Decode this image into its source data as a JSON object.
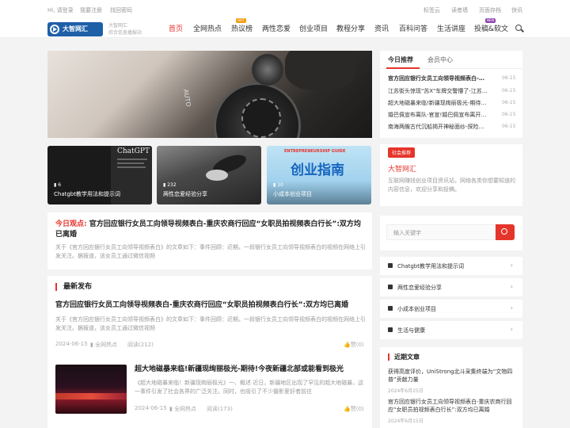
{
  "topbar": {
    "left": [
      "Hi, 请登录",
      "我要注册",
      "找回密码"
    ],
    "right": [
      "标签云",
      "读者墙",
      "页面存档",
      "快讯"
    ]
  },
  "brand": {
    "logo": "大智网汇",
    "sub_line1": "大智网汇",
    "sub_line2": "综合信息播报站"
  },
  "nav": {
    "items": [
      "首页",
      "全网热点",
      "热议榜",
      "两性恋爱",
      "创业项目",
      "教程分享",
      "资讯",
      "百科问答",
      "生活讲座",
      "投稿&软文"
    ],
    "hot_badge": "HOT",
    "new_badge": "NEW"
  },
  "thumbs": [
    {
      "label": "Chatgbt教学用法和提示词",
      "count": "6",
      "image_text": "ChatGPT"
    },
    {
      "label": "两性恋爱经验分享",
      "count": "232"
    },
    {
      "label": "小成本创业项目",
      "count": "10",
      "image_text": "创业指南",
      "image_sub": "ENTREPRENEURSHIP GUIDE"
    }
  ],
  "hero": {
    "text": "AUTO"
  },
  "featured": {
    "prefix": "今日观点:",
    "title": "官方回应银行女员工向领导视频表白-重庆农商行回应“女职员拍视频表白行长”:双方均已离婚",
    "desc": "关于《官方回应银行女员工向领导视频表白》的文章如下：事件回顾：近期，一段银行女员工向领导视频表白的视频在网络上引发关注。据报道，该女员工通过微信视频"
  },
  "latest": {
    "heading": "最新发布",
    "articles": [
      {
        "title": "官方回应银行女员工向领导视频表白-重庆农商行回应“女职员拍视频表白行长”:双方均已离婚",
        "desc": "关于《官方回应银行女员工向领导视频表白》的文章如下：事件回顾：近期，一段银行女员工向领导视频表白的视频在网络上引发关注。据报道，该女员工通过微信视频",
        "date": "2024-06-15",
        "category": "全网热点",
        "views": "阅读(212)",
        "likes": "赞(0)"
      },
      {
        "title": "超大地磁暴来临!新疆现绚丽极光-期待!今夜新疆北部或能看到极光",
        "desc": "《超大地磁暴来临！新疆现绚丽极光》一、概述 近日，新疆地区出现了罕见的超大地磁暴，这一事件引发了社会各界的广泛关注。同时，也吸引了不少摄影爱好者前往",
        "date": "2024-06-15",
        "category": "全网热点",
        "views": "阅读(173)",
        "likes": "赞(0)"
      }
    ]
  },
  "sidebar": {
    "tabs": [
      "今日推荐",
      "会员中心"
    ],
    "recommended": [
      {
        "title": "官方回应银行女员工向领导视频表白-重庆农商行回应",
        "date": "06-15"
      },
      {
        "title": "江苏街头惊现\"苏X\"车牌交警懵了-江苏街头惊现苏X车牌",
        "date": "06-15"
      },
      {
        "title": "超大地磁暴来临!新疆现绚丽极光-期待!今夜新疆北部",
        "date": "06-15"
      },
      {
        "title": "婚巴佩宣布离队-官宣!婚巴佩宣布离开巴黎，将加盟",
        "date": "06-15"
      },
      {
        "title": "南海两艘古代沉船揭开神秘面纱-探险揭秘:南海两艘",
        "date": "06-15"
      }
    ],
    "social_badge": "社会推荐",
    "site_name": "大智网汇",
    "site_desc": "互联网赚钱创业项目资讯站，网络各类你想要知道的内容信息，欢迎分享和投稿。",
    "search_placeholder": "输入关键字",
    "categories": [
      "Chatgbt教学用法和提示词",
      "两性恋爱经验分享",
      "小成本创业项目",
      "生活与健康"
    ],
    "recent_heading": "近期文章",
    "recent": [
      {
        "title": "获得高度评价，UniStrong北斗采集终端为“文物四普”贡献力量",
        "date": "2024年6月25日"
      },
      {
        "title": "官方回应银行女员工向领导视频表白-重庆农商行回应“女职员拍视频表白行长”:双方均已离婚",
        "date": "2024年6月15日"
      }
    ]
  },
  "colors": {
    "accent": "#e5352b",
    "brand": "#1e5fa8"
  }
}
